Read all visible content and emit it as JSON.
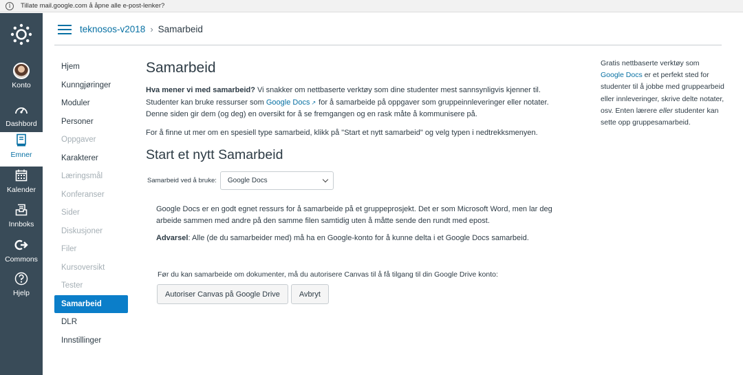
{
  "browser": {
    "notification": "Tillate mail.google.com å åpne alle e-post-lenker?"
  },
  "global_nav": {
    "items": [
      {
        "label": "Konto",
        "icon": "avatar"
      },
      {
        "label": "Dashbord",
        "icon": "speedometer-icon"
      },
      {
        "label": "Emner",
        "icon": "book-icon"
      },
      {
        "label": "Kalender",
        "icon": "calendar-icon"
      },
      {
        "label": "Innboks",
        "icon": "inbox-icon"
      },
      {
        "label": "Commons",
        "icon": "commons-icon"
      },
      {
        "label": "Hjelp",
        "icon": "question-icon"
      }
    ],
    "active": "Emner",
    "colors": {
      "background": "#394b58",
      "active_text": "#0770a3"
    }
  },
  "breadcrumb": {
    "course": "teknosos-v2018",
    "separator": "›",
    "current": "Samarbeid"
  },
  "course_nav": {
    "items": [
      {
        "label": "Hjem",
        "state": "normal"
      },
      {
        "label": "Kunngjøringer",
        "state": "normal"
      },
      {
        "label": "Moduler",
        "state": "normal"
      },
      {
        "label": "Personer",
        "state": "normal"
      },
      {
        "label": "Oppgaver",
        "state": "disabled"
      },
      {
        "label": "Karakterer",
        "state": "normal"
      },
      {
        "label": "Læringsmål",
        "state": "disabled"
      },
      {
        "label": "Konferanser",
        "state": "disabled"
      },
      {
        "label": "Sider",
        "state": "disabled"
      },
      {
        "label": "Diskusjoner",
        "state": "disabled"
      },
      {
        "label": "Filer",
        "state": "disabled"
      },
      {
        "label": "Kursoversikt",
        "state": "disabled"
      },
      {
        "label": "Tester",
        "state": "disabled"
      },
      {
        "label": "Samarbeid",
        "state": "active"
      },
      {
        "label": "DLR",
        "state": "normal"
      },
      {
        "label": "Innstillinger",
        "state": "normal"
      }
    ],
    "active_color": "#0b7ec9"
  },
  "main": {
    "title": "Samarbeid",
    "intro": {
      "bold": "Hva mener vi med samarbeid?",
      "text1": " Vi snakker om nettbaserte verktøy som dine studenter mest sannsynligvis kjenner til. Studenter kan bruke ressurser som ",
      "link": "Google Docs",
      "text2": "for å samarbeide på oppgaver som gruppeinnleveringer eller notater. Denne siden gir dem (og deg) en oversikt for å se fremgangen og en rask måte å kommunisere på."
    },
    "hint": "For å finne ut mer om en spesiell type samarbeid, klikk på \"Start et nytt samarbeid\" og velg typen i nedtrekksmenyen.",
    "start_title": "Start et nytt Samarbeid",
    "select_label": "Samarbeid ved å bruke:",
    "select_value": "Google Docs",
    "description": "Google Docs er en godt egnet ressurs for å samarbeide på et gruppeprosjekt. Det er som Microsoft Word, men lar deg arbeide sammen med andre på den samme filen samtidig uten å måtte sende den rundt med epost.",
    "warning_bold": "Advarsel",
    "warning_text": ": Alle (de du samarbeider med) må ha en Google-konto for å kunne delta i et Google Docs samarbeid.",
    "auth_text": "Før du kan samarbeide om dokumenter, må du autorisere Canvas til å få tilgang til din Google Drive konto:",
    "authorize_button": "Autoriser Canvas på Google Drive",
    "cancel_button": "Avbryt"
  },
  "aside": {
    "text1": "Gratis nettbaserte verktøy som ",
    "link": "Google Docs",
    "text2": " er et perfekt sted for studenter til å jobbe med gruppearbeid eller innleveringer, skrive delte notater, osv. Enten lærere ",
    "italic": "eller",
    "text3": " studenter kan sette opp gruppesamarbeid."
  }
}
